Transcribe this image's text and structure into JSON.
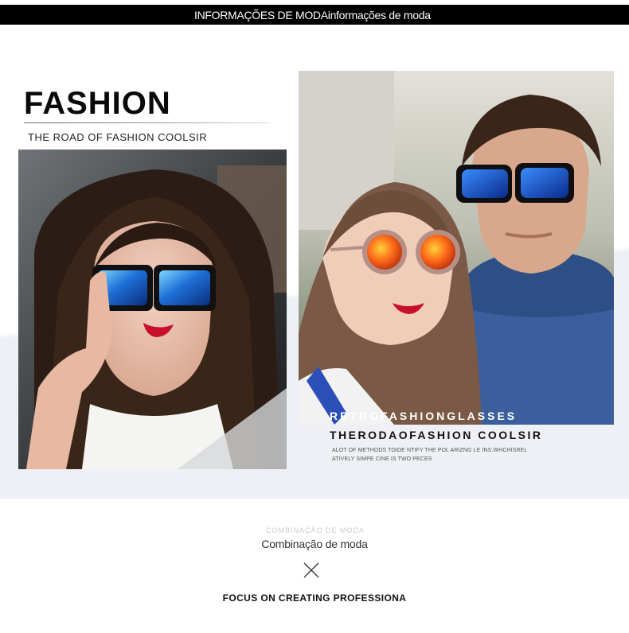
{
  "header": {
    "title": "INFORMAÇÕES DE MODAinformações de moda"
  },
  "hero": {
    "heading": "FASHION",
    "subheading": "THE ROAD OF FASHION COOLSIR"
  },
  "feature": {
    "overlay_title": "RETROFASHIONGLASSES",
    "title": "THERODAOFASHION COOLSIR",
    "description_line1": "ALOT OF METHODS TOIDE NTIFY THE POL ARIZNG LE INS.WHCHISREL",
    "description_line2": "ATIVELY SIMPE CINE IS TWO PECES"
  },
  "section": {
    "faded_text": "COMBINAÇÃO DE MODA",
    "title": "Combinação de moda",
    "icon": "close-x-icon",
    "tagline": "FOCUS ON CREATING PROFESSIONA"
  },
  "colors": {
    "bar": "#000000",
    "text_dark": "#111111",
    "lens_blue": "#1e6fd6",
    "lens_orange": "#ff6a1a",
    "lips": "#c8102e"
  }
}
